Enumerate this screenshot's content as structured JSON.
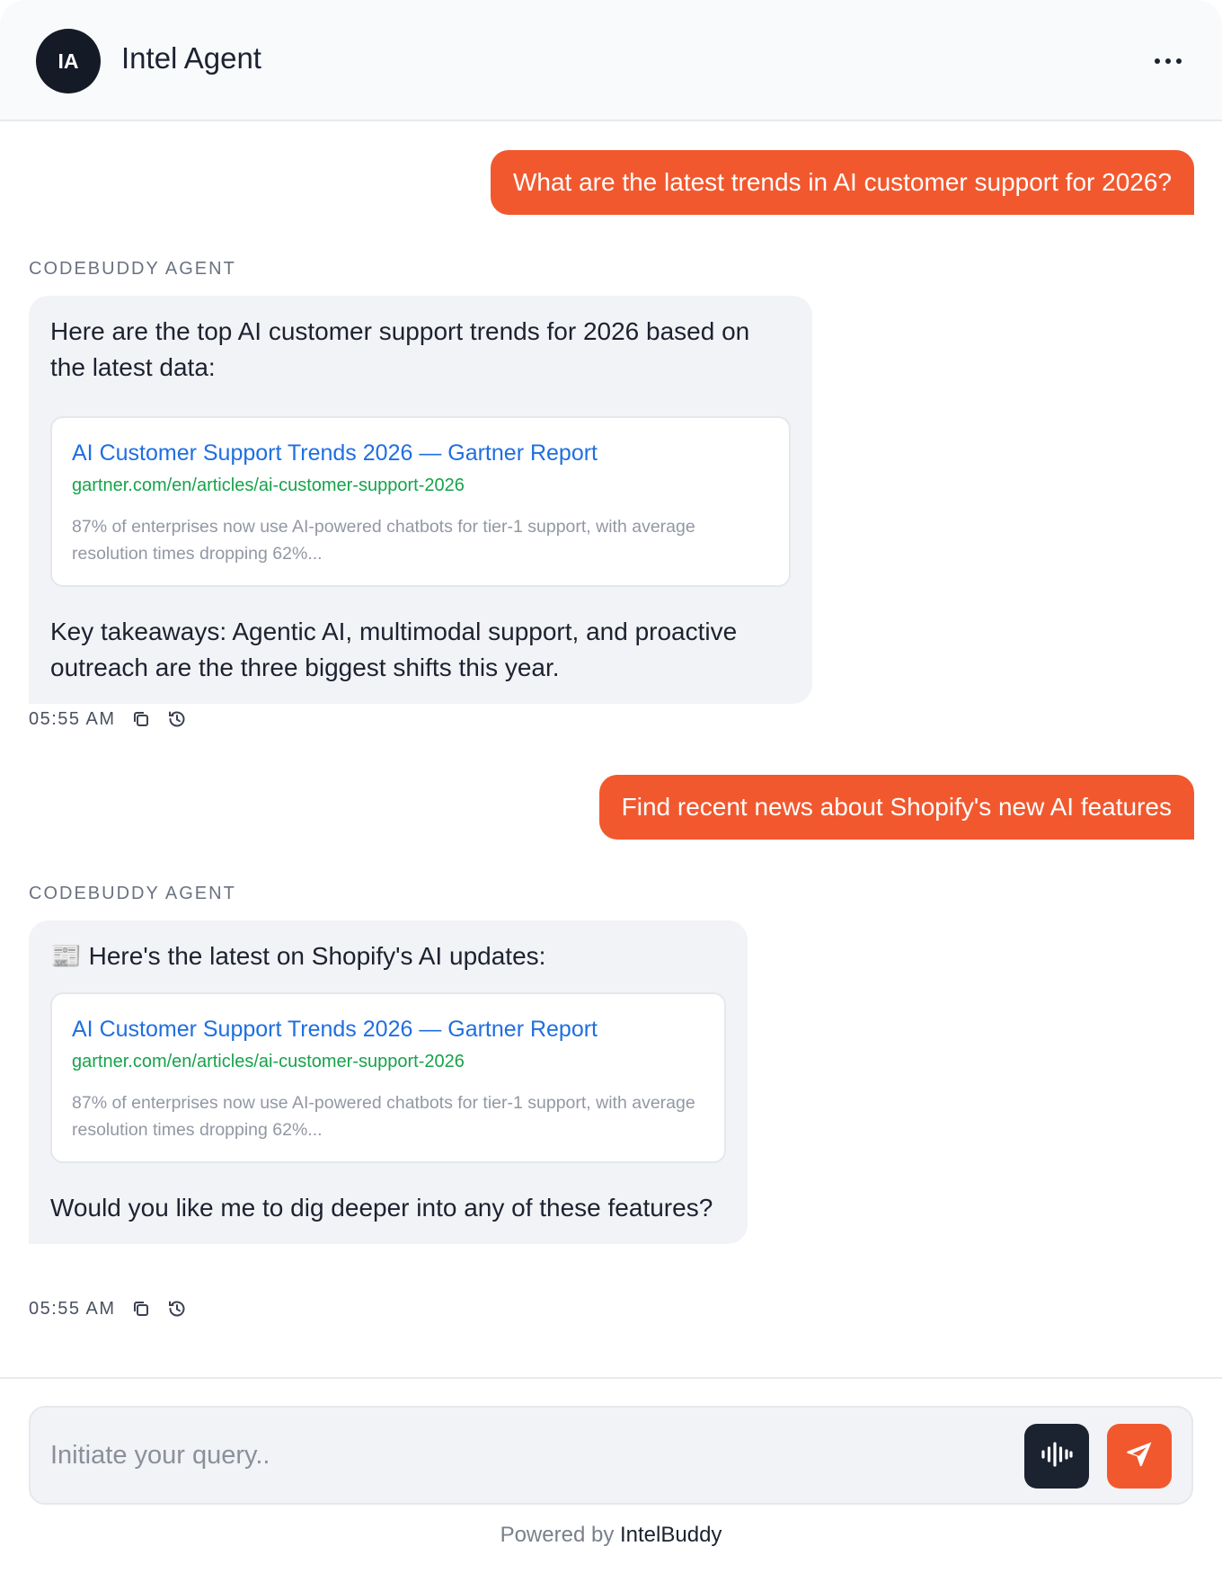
{
  "header": {
    "avatar_initials": "IA",
    "agent_name": "Intel Agent",
    "more_icon": "more-horizontal-icon"
  },
  "conversation": [
    {
      "role": "user",
      "text": "What are the latest trends in AI customer support for 2026?"
    },
    {
      "role": "agent",
      "sender_label": "CODEBUDDY AGENT",
      "intro": "Here are the top AI customer support trends for 2026 based on the latest data:",
      "link_card": {
        "title": "AI Customer Support Trends 2026 — Gartner Report",
        "url": "gartner.com/en/articles/ai-customer-support-2026",
        "snippet": "87% of enterprises now use AI-powered chatbots for tier-1 support, with average resolution times dropping 62%..."
      },
      "outro": "Key takeaways: Agentic AI, multimodal support, and proactive outreach are the three biggest shifts this year.",
      "time": "05:55 AM"
    },
    {
      "role": "user",
      "text": "Find recent news about Shopify's new AI features"
    },
    {
      "role": "agent",
      "sender_label": "CODEBUDDY AGENT",
      "intro": "📰 Here's the latest on Shopify's AI updates:",
      "link_card": {
        "title": "AI Customer Support Trends 2026 — Gartner Report",
        "url": "gartner.com/en/articles/ai-customer-support-2026",
        "snippet": "87% of enterprises now use AI-powered chatbots for tier-1 support, with average resolution times dropping 62%..."
      },
      "outro": "Would you like me to dig deeper into any of these features?",
      "time": "05:55 AM"
    }
  ],
  "composer": {
    "placeholder": "Initiate your query..",
    "voice_icon": "audio-waveform-icon",
    "send_icon": "send-icon"
  },
  "footer": {
    "prefix": "Powered by",
    "brand": "IntelBuddy"
  },
  "colors": {
    "accent": "#f2582e",
    "dark": "#1b2230",
    "link": "#1f6fe0",
    "url": "#16a34a"
  }
}
